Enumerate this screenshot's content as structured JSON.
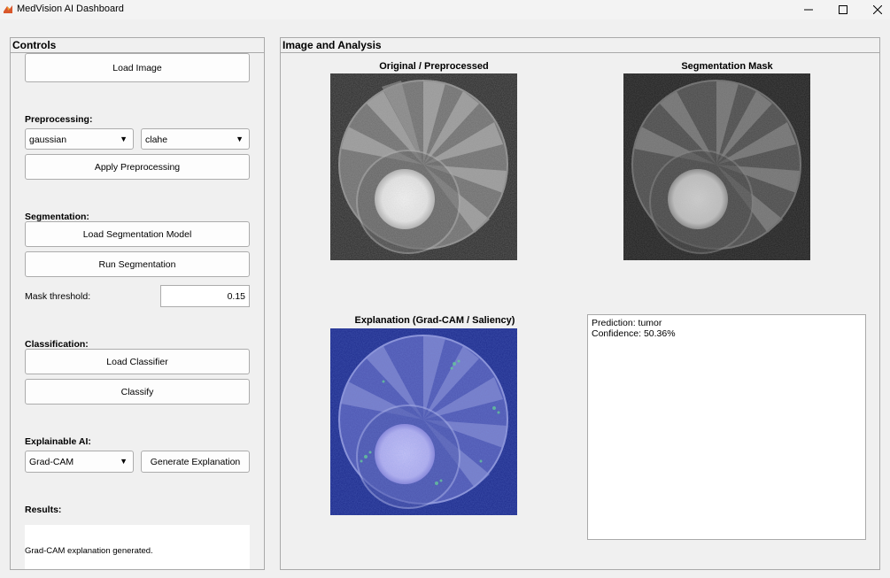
{
  "window": {
    "title": "MedVision AI Dashboard"
  },
  "controls": {
    "panel_title": "Controls",
    "load_image_label": "Load Image",
    "preprocessing_heading": "Preprocessing:",
    "filter_dropdown_value": "gaussian",
    "enhance_dropdown_value": "clahe",
    "apply_preprocessing_label": "Apply Preprocessing",
    "segmentation_heading": "Segmentation:",
    "load_segmentation_model_label": "Load Segmentation Model",
    "run_segmentation_label": "Run Segmentation",
    "mask_threshold_label": "Mask threshold:",
    "mask_threshold_value": "0.15",
    "classification_heading": "Classification:",
    "load_classifier_label": "Load Classifier",
    "classify_label": "Classify",
    "xai_heading": "Explainable AI:",
    "xai_method_value": "Grad-CAM",
    "generate_explanation_label": "Generate Explanation",
    "results_heading": "Results:",
    "results_text": "Grad-CAM explanation generated."
  },
  "analysis": {
    "panel_title": "Image and Analysis",
    "original_title": "Original / Preprocessed",
    "mask_title": "Segmentation Mask",
    "explanation_title": "Explanation (Grad-CAM / Saliency)",
    "prediction_line": "Prediction: tumor",
    "confidence_line": "Confidence: 50.36%"
  }
}
